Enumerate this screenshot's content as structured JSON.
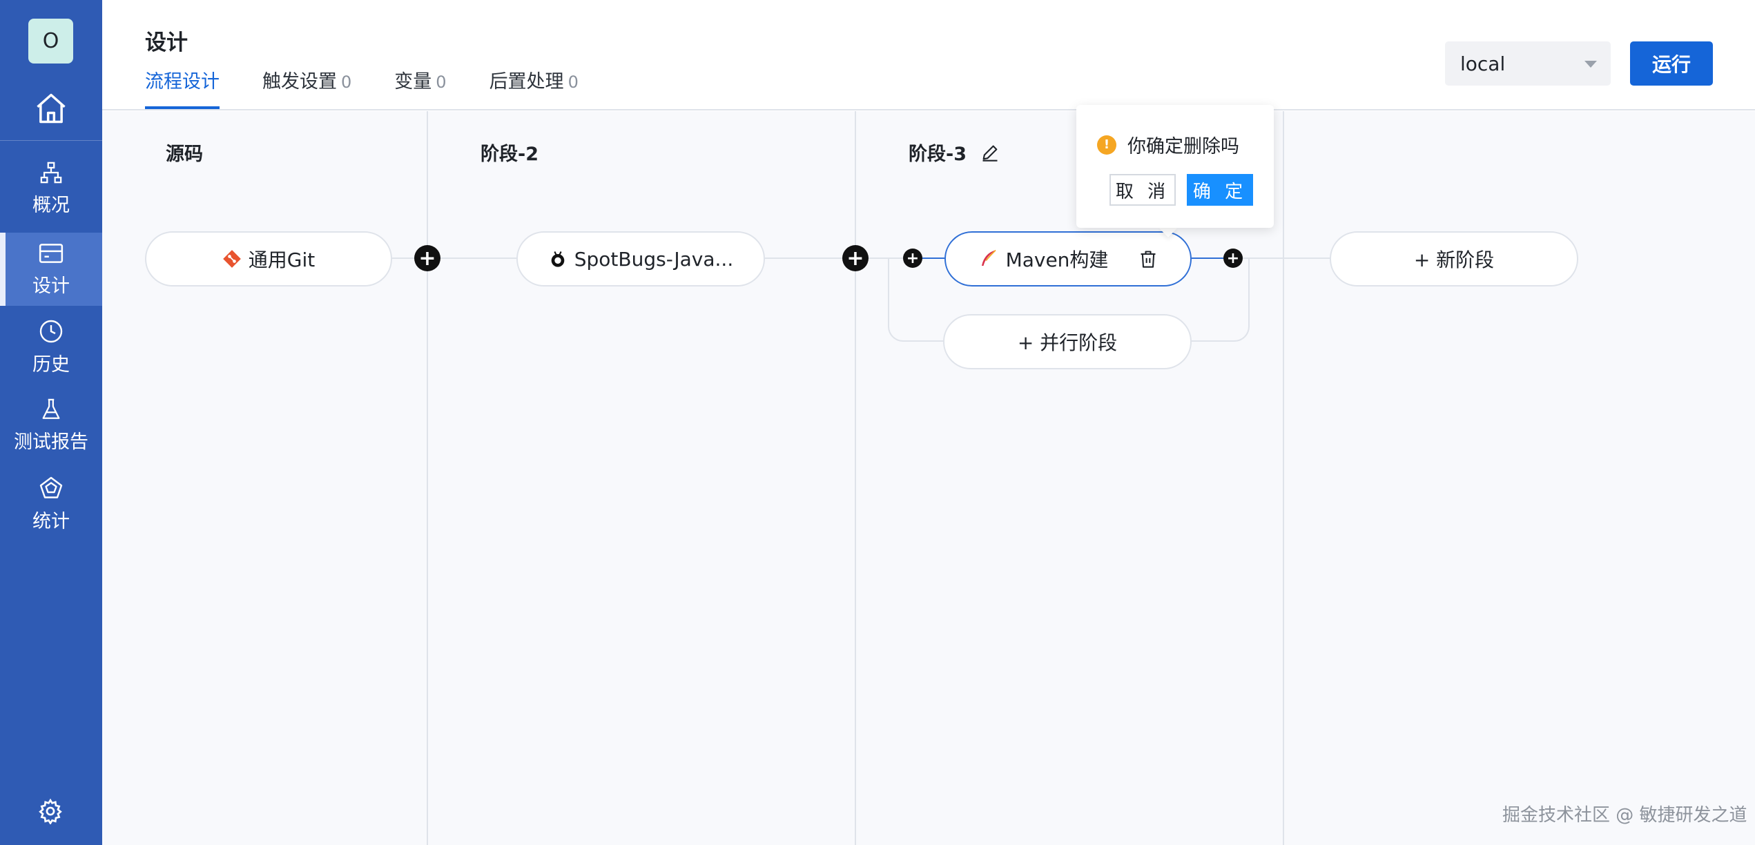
{
  "sidebar": {
    "avatar_letter": "O",
    "items": [
      {
        "label": "概况",
        "icon": "sitemap-icon"
      },
      {
        "label": "设计",
        "icon": "card-icon",
        "active": true
      },
      {
        "label": "历史",
        "icon": "clock-icon"
      },
      {
        "label": "测试报告",
        "icon": "flask-icon"
      },
      {
        "label": "统计",
        "icon": "radar-icon"
      }
    ]
  },
  "header": {
    "title": "设计",
    "tabs": [
      {
        "label": "流程设计",
        "count": "",
        "active": true
      },
      {
        "label": "触发设置",
        "count": "0"
      },
      {
        "label": "变量",
        "count": "0"
      },
      {
        "label": "后置处理",
        "count": "0"
      }
    ],
    "env_select": {
      "value": "local"
    },
    "run_label": "运行"
  },
  "stages": [
    {
      "title": "源码",
      "job": "通用Git",
      "job_icon": "git-icon"
    },
    {
      "title": "阶段-2",
      "job": "SpotBugs-Java...",
      "job_icon": "bug-icon"
    },
    {
      "title": "阶段-3",
      "job": "Maven构建",
      "job_icon": "feather-icon",
      "parallel_label": "+ 并行阶段"
    }
  ],
  "new_stage_label": "+ 新阶段",
  "popconfirm": {
    "message": "你确定删除吗",
    "cancel_label": "取 消",
    "ok_label": "确 定"
  },
  "watermark": "掘金技术社区 @ 敏捷研发之道",
  "colors": {
    "sidebar": "#2f5bb4",
    "primary": "#1565d8",
    "confirm": "#1890ff",
    "warning": "#f5a623"
  }
}
